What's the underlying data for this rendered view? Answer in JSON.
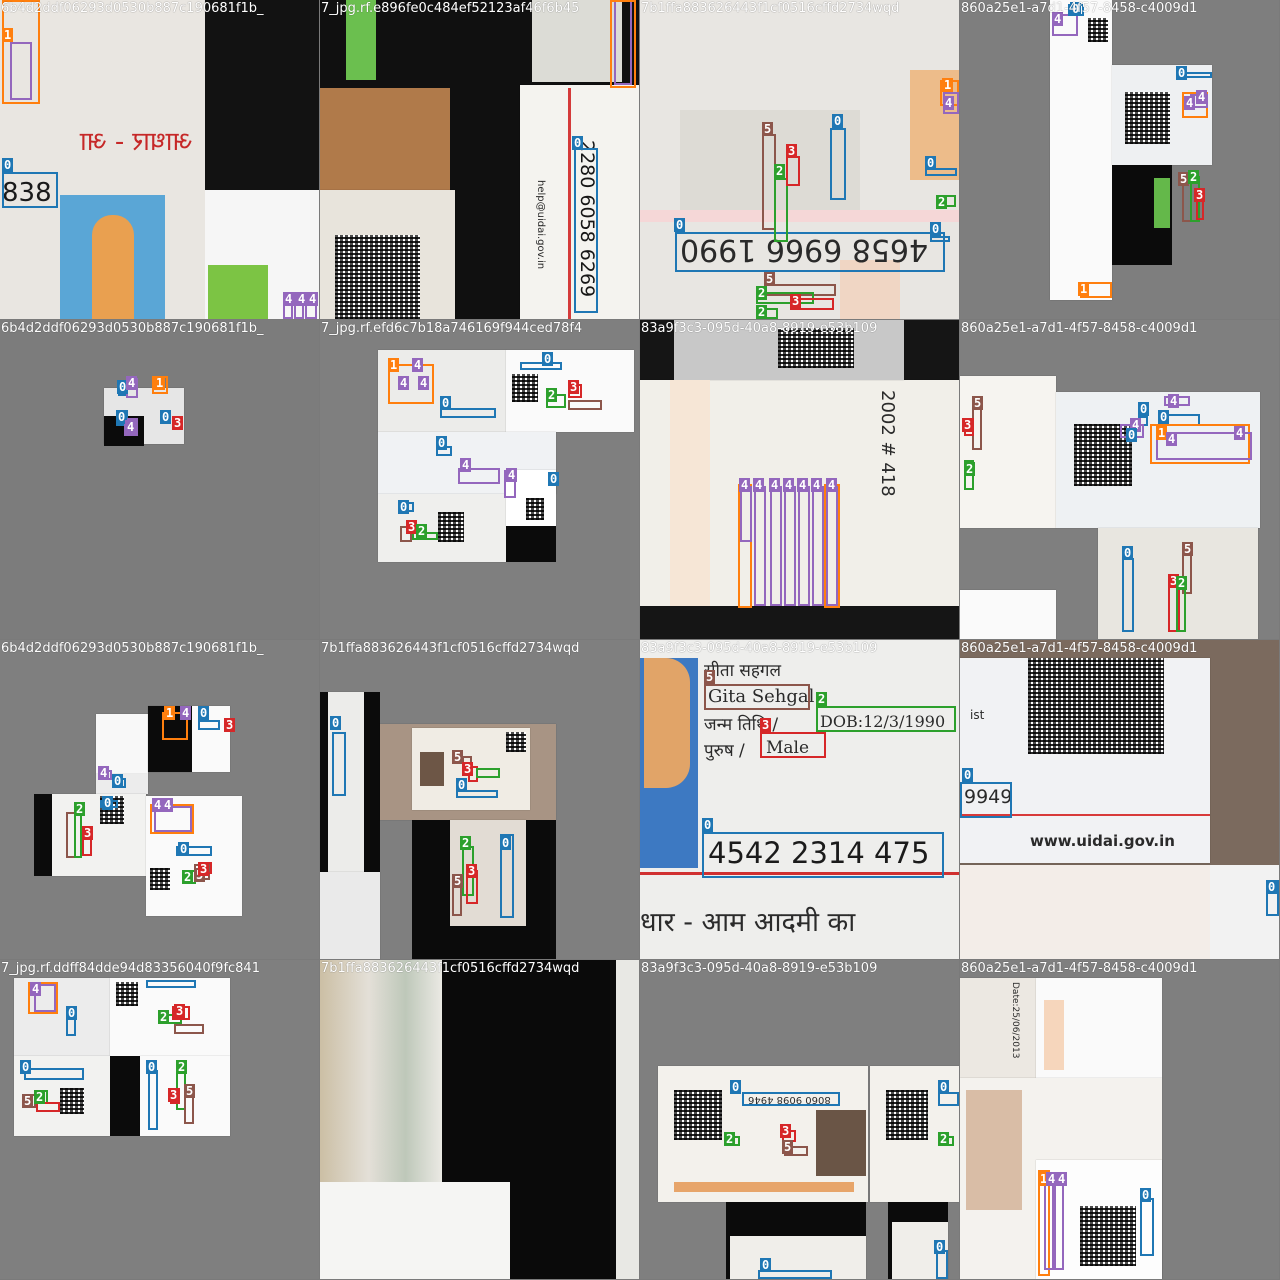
{
  "class_colors": {
    "0": "#1f77b4",
    "1": "#ff7f0e",
    "2": "#2ca02c",
    "3": "#d62728",
    "4": "#9467bd",
    "5": "#8c564b"
  },
  "tiles": [
    {
      "caption": "6b4d2ddf06293d0530b887c190681f1b_",
      "texts": [
        "838",
        "आधार - आ"
      ],
      "boxes": [
        {
          "c": 0
        },
        {
          "c": 1
        },
        {
          "c": 4
        },
        {
          "c": 4
        },
        {
          "c": 4
        },
        {
          "c": 4
        }
      ]
    },
    {
      "caption": "7_jpg.rf.e896fe0c484ef52123af46f6b45",
      "texts": [
        "2280 6058 6269",
        "help@uidai.gov.in"
      ],
      "boxes": [
        {
          "c": 0
        }
      ]
    },
    {
      "caption": "7b1ffa883626443f1cf0516cffd2734wqd",
      "texts": [
        "4658 6966 1990"
      ],
      "boxes": [
        {
          "c": 0
        },
        {
          "c": 0
        },
        {
          "c": 0
        },
        {
          "c": 0
        },
        {
          "c": 1
        },
        {
          "c": 2
        },
        {
          "c": 2
        },
        {
          "c": 2
        },
        {
          "c": 3
        },
        {
          "c": 3
        },
        {
          "c": 4
        },
        {
          "c": 5
        },
        {
          "c": 5
        }
      ]
    },
    {
      "caption": "860a25e1-a7d1-4f57-8458-c4009d1",
      "texts": [],
      "boxes": [
        {
          "c": 0
        },
        {
          "c": 0
        },
        {
          "c": 1
        },
        {
          "c": 2
        },
        {
          "c": 3
        },
        {
          "c": 4
        },
        {
          "c": 4
        },
        {
          "c": 5
        }
      ]
    },
    {
      "caption": "6b4d2ddf06293d0530b887c190681f1b_",
      "texts": [],
      "boxes": [
        {
          "c": 0
        },
        {
          "c": 0
        },
        {
          "c": 1
        },
        {
          "c": 4
        },
        {
          "c": 4
        },
        {
          "c": 3
        }
      ]
    },
    {
      "caption": "7_jpg.rf.efd6c7b18a746169f944ced78f4",
      "texts": [],
      "boxes": [
        {
          "c": 0
        },
        {
          "c": 0
        },
        {
          "c": 0
        },
        {
          "c": 0
        },
        {
          "c": 1
        },
        {
          "c": 2
        },
        {
          "c": 2
        },
        {
          "c": 3
        },
        {
          "c": 3
        },
        {
          "c": 4
        },
        {
          "c": 4
        },
        {
          "c": 4
        },
        {
          "c": 4
        },
        {
          "c": 5
        }
      ]
    },
    {
      "caption": "83a9f3c3-095d-40a8-8919-e53b109",
      "texts": [
        "2002 # 418"
      ],
      "boxes": [
        {
          "c": 1
        },
        {
          "c": 4
        },
        {
          "c": 4
        },
        {
          "c": 4
        },
        {
          "c": 4
        },
        {
          "c": 4
        },
        {
          "c": 4
        },
        {
          "c": 4
        },
        {
          "c": 4
        }
      ]
    },
    {
      "caption": "860a25e1-a7d1-4f57-8458-c4009d1",
      "texts": [],
      "boxes": [
        {
          "c": 0
        },
        {
          "c": 0
        },
        {
          "c": 0
        },
        {
          "c": 1
        },
        {
          "c": 2
        },
        {
          "c": 2
        },
        {
          "c": 3
        },
        {
          "c": 3
        },
        {
          "c": 4
        },
        {
          "c": 4
        },
        {
          "c": 4
        },
        {
          "c": 5
        },
        {
          "c": 5
        }
      ]
    },
    {
      "caption": "6b4d2ddf06293d0530b887c190681f1b_",
      "texts": [],
      "boxes": [
        {
          "c": 0
        },
        {
          "c": 0
        },
        {
          "c": 0
        },
        {
          "c": 0
        },
        {
          "c": 1
        },
        {
          "c": 2
        },
        {
          "c": 2
        },
        {
          "c": 3
        },
        {
          "c": 3
        },
        {
          "c": 4
        },
        {
          "c": 4
        },
        {
          "c": 4
        },
        {
          "c": 4
        },
        {
          "c": 5
        }
      ]
    },
    {
      "caption": "7b1ffa883626443f1cf0516cffd2734wqd",
      "texts": [],
      "boxes": [
        {
          "c": 0
        },
        {
          "c": 0
        },
        {
          "c": 0
        },
        {
          "c": 2
        },
        {
          "c": 3
        },
        {
          "c": 3
        },
        {
          "c": 5
        },
        {
          "c": 5
        }
      ]
    },
    {
      "caption": "83a9f3c3-095d-40a8-8919-e53b109",
      "texts": [
        "सीता सहगल",
        "Gita Sehgal",
        "जन्म तिथि /",
        "DOB:12/3/1990",
        "पुरुष /",
        "Male",
        "4542 2314 475",
        "धार - आम आदमी का"
      ],
      "boxes": [
        {
          "c": 5
        },
        {
          "c": 2
        },
        {
          "c": 3
        },
        {
          "c": 0
        }
      ]
    },
    {
      "caption": "860a25e1-a7d1-4f57-8458-c4009d1",
      "texts": [
        "9949",
        "www.uidai.gov.in",
        "ist"
      ],
      "boxes": [
        {
          "c": 0
        },
        {
          "c": 0
        }
      ]
    },
    {
      "caption": "7_jpg.rf.ddff84dde94d83356040f9fc841",
      "texts": [],
      "boxes": [
        {
          "c": 0
        },
        {
          "c": 0
        },
        {
          "c": 0
        },
        {
          "c": 1
        },
        {
          "c": 2
        },
        {
          "c": 2
        },
        {
          "c": 2
        },
        {
          "c": 3
        },
        {
          "c": 3
        },
        {
          "c": 4
        },
        {
          "c": 4
        },
        {
          "c": 5
        },
        {
          "c": 5
        }
      ]
    },
    {
      "caption": "7b1ffa883626443f1cf0516cffd2734wqd",
      "texts": [],
      "boxes": []
    },
    {
      "caption": "83a9f3c3-095d-40a8-8919-e53b109",
      "texts": [
        "8060 9098 4946"
      ],
      "boxes": [
        {
          "c": 0
        },
        {
          "c": 0
        },
        {
          "c": 0
        },
        {
          "c": 0
        },
        {
          "c": 2
        },
        {
          "c": 2
        },
        {
          "c": 3
        },
        {
          "c": 5
        }
      ]
    },
    {
      "caption": "860a25e1-a7d1-4f57-8458-c4009d1",
      "texts": [
        "Date:25/06/2013"
      ],
      "boxes": [
        {
          "c": 0
        },
        {
          "c": 1
        },
        {
          "c": 4
        },
        {
          "c": 4
        }
      ]
    }
  ]
}
